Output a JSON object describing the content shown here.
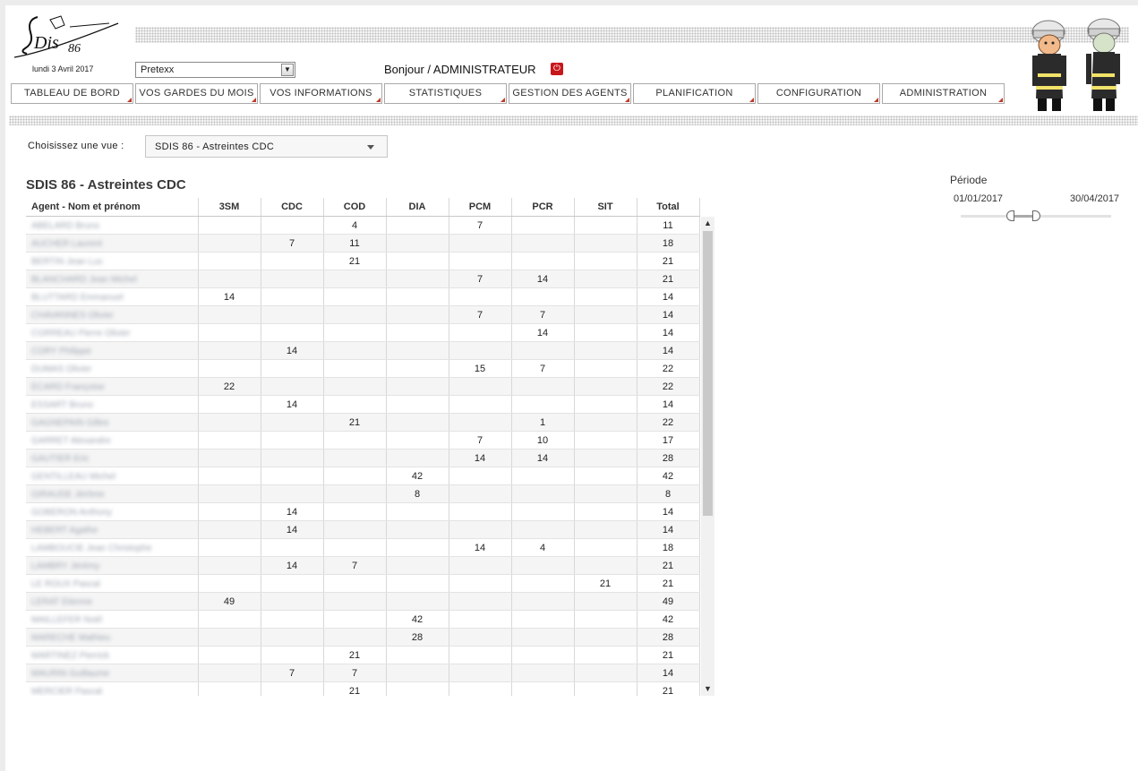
{
  "header": {
    "date": "lundi 3 Avril 2017",
    "site_select": "Pretexx",
    "greeting": "Bonjour / ADMINISTRATEUR"
  },
  "nav": [
    "TABLEAU DE BORD",
    "VOS GARDES DU MOIS",
    "VOS INFORMATIONS",
    "STATISTIQUES",
    "GESTION DES AGENTS",
    "PLANIFICATION",
    "CONFIGURATION",
    "ADMINISTRATION"
  ],
  "view": {
    "label": "Choisissez une vue :",
    "selected": "SDIS 86 - Astreintes CDC"
  },
  "sheet_title": "SDIS 86 - Astreintes CDC",
  "table": {
    "columns": [
      "Agent - Nom et prénom",
      "3SM",
      "CDC",
      "COD",
      "DIA",
      "PCM",
      "PCR",
      "SIT",
      "Total"
    ],
    "rows": [
      [
        "ABELARD Bruno",
        "",
        "",
        "4",
        "",
        "7",
        "",
        "",
        "11"
      ],
      [
        "AUCHER Laurent",
        "",
        "7",
        "11",
        "",
        "",
        "",
        "",
        "18"
      ],
      [
        "BERTIN Jean Luc",
        "",
        "",
        "21",
        "",
        "",
        "",
        "",
        "21"
      ],
      [
        "BLANCHARD Jean Michel",
        "",
        "",
        "",
        "",
        "7",
        "14",
        "",
        "21"
      ],
      [
        "BLUTTARD Emmanuel",
        "14",
        "",
        "",
        "",
        "",
        "",
        "",
        "14"
      ],
      [
        "CHAVANNES Olivier",
        "",
        "",
        "",
        "",
        "7",
        "7",
        "",
        "14"
      ],
      [
        "CORREAU Pierre Olivier",
        "",
        "",
        "",
        "",
        "",
        "14",
        "",
        "14"
      ],
      [
        "CORY Philippe",
        "",
        "14",
        "",
        "",
        "",
        "",
        "",
        "14"
      ],
      [
        "DUMAS Olivier",
        "",
        "",
        "",
        "",
        "15",
        "7",
        "",
        "22"
      ],
      [
        "ECARD Françoise",
        "22",
        "",
        "",
        "",
        "",
        "",
        "",
        "22"
      ],
      [
        "ESSART Bruno",
        "",
        "14",
        "",
        "",
        "",
        "",
        "",
        "14"
      ],
      [
        "GAGNEPAIN Gilles",
        "",
        "",
        "21",
        "",
        "",
        "1",
        "",
        "22"
      ],
      [
        "GARRET Alexandre",
        "",
        "",
        "",
        "",
        "7",
        "10",
        "",
        "17"
      ],
      [
        "GAUTIER Eric",
        "",
        "",
        "",
        "",
        "14",
        "14",
        "",
        "28"
      ],
      [
        "GENTILLEAU Michel",
        "",
        "",
        "",
        "42",
        "",
        "",
        "",
        "42"
      ],
      [
        "GIRAUDE Jérôme",
        "",
        "",
        "",
        "8",
        "",
        "",
        "",
        "8"
      ],
      [
        "GOBERON Anthony",
        "",
        "14",
        "",
        "",
        "",
        "",
        "",
        "14"
      ],
      [
        "HEBERT Agathe",
        "",
        "14",
        "",
        "",
        "",
        "",
        "",
        "14"
      ],
      [
        "LAMBOUCIE Jean Christophe",
        "",
        "",
        "",
        "",
        "14",
        "4",
        "",
        "18"
      ],
      [
        "LAMBRY Jérémy",
        "",
        "14",
        "7",
        "",
        "",
        "",
        "",
        "21"
      ],
      [
        "LE ROUX Pascal",
        "",
        "",
        "",
        "",
        "",
        "",
        "21",
        "21"
      ],
      [
        "LERAT Etienne",
        "49",
        "",
        "",
        "",
        "",
        "",
        "",
        "49"
      ],
      [
        "MAILLEFER Noël",
        "",
        "",
        "",
        "42",
        "",
        "",
        "",
        "42"
      ],
      [
        "MARECHE Mathieu",
        "",
        "",
        "",
        "28",
        "",
        "",
        "",
        "28"
      ],
      [
        "MARTINEZ Pierrick",
        "",
        "",
        "21",
        "",
        "",
        "",
        "",
        "21"
      ],
      [
        "MAURIN Guillaume",
        "",
        "7",
        "7",
        "",
        "",
        "",
        "",
        "14"
      ],
      [
        "MERCIER Pascal",
        "",
        "",
        "21",
        "",
        "",
        "",
        "",
        "21"
      ]
    ]
  },
  "periode": {
    "label": "Période",
    "start": "01/01/2017",
    "end": "30/04/2017"
  }
}
